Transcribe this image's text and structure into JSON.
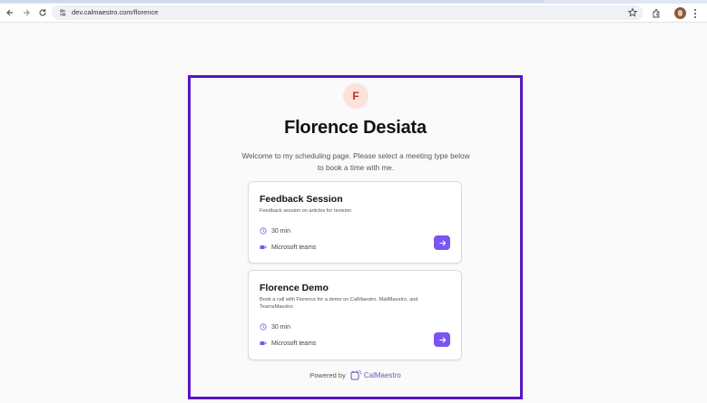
{
  "browser": {
    "url": "dev.calmaestro.com/florence"
  },
  "profile": {
    "initial": "F",
    "name": "Florence Desiata",
    "welcome": "Welcome to my scheduling page. Please select a meeting type below to book a time with me."
  },
  "meetings": [
    {
      "title": "Feedback Session",
      "description": "Feedback session on articles for revision",
      "duration": "30 min",
      "location": "Microsoft teams"
    },
    {
      "title": "Florence Demo",
      "description": "Book a call with Florence for a demo on CalMaestro, MailMaestro, and TeamsMaestro",
      "duration": "30 min",
      "location": "Microsoft teams"
    }
  ],
  "footer": {
    "powered_by": "Powered by",
    "brand": "CalMaestro"
  },
  "colors": {
    "frame": "#5b13c7",
    "accent": "#7a55f0",
    "avatar_bg": "#fde2dc"
  }
}
